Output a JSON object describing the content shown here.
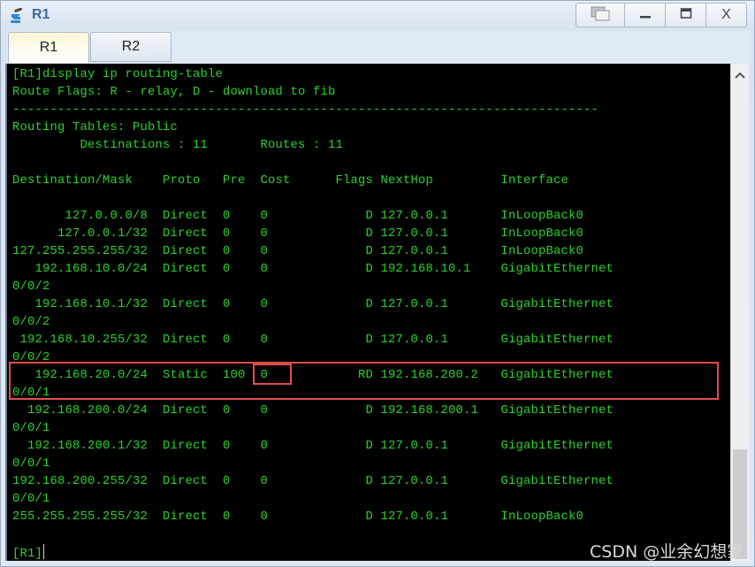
{
  "window": {
    "title": "R1",
    "icon": "network-device-icon",
    "controls": {
      "restore_icon": "restore-windows-icon",
      "minimize": "_",
      "maximize": "▭",
      "close": "X"
    }
  },
  "tabs": [
    {
      "label": "R1",
      "active": true
    },
    {
      "label": "R2",
      "active": false
    }
  ],
  "terminal": {
    "command_line": "[R1]display ip routing-table",
    "route_flags": "Route Flags: R - relay, D - download to fib",
    "separator": "------------------------------------------------------------------------------",
    "tables_line": "Routing Tables: Public",
    "summary_line": "         Destinations : 11       Routes : 11",
    "header": "Destination/Mask    Proto   Pre  Cost      Flags NextHop         Interface",
    "routes": [
      {
        "destination": "127.0.0.0/8",
        "proto": "Direct",
        "pre": "0",
        "cost": "0",
        "flags": "D",
        "nexthop": "127.0.0.1",
        "interface": "InLoopBack0",
        "interface_cont": ""
      },
      {
        "destination": "127.0.0.1/32",
        "proto": "Direct",
        "pre": "0",
        "cost": "0",
        "flags": "D",
        "nexthop": "127.0.0.1",
        "interface": "InLoopBack0",
        "interface_cont": ""
      },
      {
        "destination": "127.255.255.255/32",
        "proto": "Direct",
        "pre": "0",
        "cost": "0",
        "flags": "D",
        "nexthop": "127.0.0.1",
        "interface": "InLoopBack0",
        "interface_cont": ""
      },
      {
        "destination": "192.168.10.0/24",
        "proto": "Direct",
        "pre": "0",
        "cost": "0",
        "flags": "D",
        "nexthop": "192.168.10.1",
        "interface": "GigabitEthernet",
        "interface_cont": "0/0/2"
      },
      {
        "destination": "192.168.10.1/32",
        "proto": "Direct",
        "pre": "0",
        "cost": "0",
        "flags": "D",
        "nexthop": "127.0.0.1",
        "interface": "GigabitEthernet",
        "interface_cont": "0/0/2"
      },
      {
        "destination": "192.168.10.255/32",
        "proto": "Direct",
        "pre": "0",
        "cost": "0",
        "flags": "D",
        "nexthop": "127.0.0.1",
        "interface": "GigabitEthernet",
        "interface_cont": "0/0/2"
      },
      {
        "destination": "192.168.20.0/24",
        "proto": "Static",
        "pre": "100",
        "cost": "0",
        "flags": "RD",
        "nexthop": "192.168.200.2",
        "interface": "GigabitEthernet",
        "interface_cont": "0/0/1",
        "highlighted": true
      },
      {
        "destination": "192.168.200.0/24",
        "proto": "Direct",
        "pre": "0",
        "cost": "0",
        "flags": "D",
        "nexthop": "192.168.200.1",
        "interface": "GigabitEthernet",
        "interface_cont": "0/0/1"
      },
      {
        "destination": "192.168.200.1/32",
        "proto": "Direct",
        "pre": "0",
        "cost": "0",
        "flags": "D",
        "nexthop": "127.0.0.1",
        "interface": "GigabitEthernet",
        "interface_cont": "0/0/1"
      },
      {
        "destination": "192.168.200.255/32",
        "proto": "Direct",
        "pre": "0",
        "cost": "0",
        "flags": "D",
        "nexthop": "127.0.0.1",
        "interface": "GigabitEthernet",
        "interface_cont": "0/0/1"
      },
      {
        "destination": "255.255.255.255/32",
        "proto": "Direct",
        "pre": "0",
        "cost": "0",
        "flags": "D",
        "nexthop": "127.0.0.1",
        "interface": "InLoopBack0",
        "interface_cont": ""
      }
    ],
    "prompt": "[R1]",
    "text_color": "#2bd42b",
    "highlight_color": "#e34b4b"
  },
  "watermark": "CSDN @业余幻想家"
}
